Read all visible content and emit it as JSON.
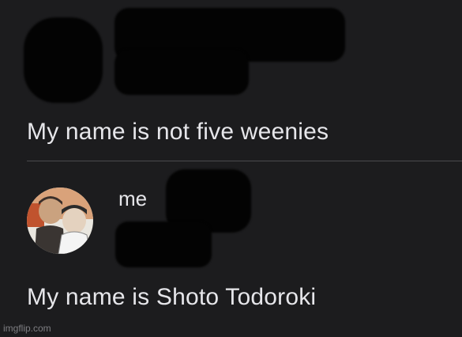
{
  "first_post": {
    "text": "My name is not five weenies"
  },
  "second_post": {
    "username": "me",
    "text": "My name is Shoto Todoroki"
  },
  "watermark": {
    "text": "imgflip.com"
  },
  "colors": {
    "background": "#1c1c1e",
    "text": "#e6e6ea",
    "divider": "#4a4a4e",
    "redaction": "#030303"
  }
}
